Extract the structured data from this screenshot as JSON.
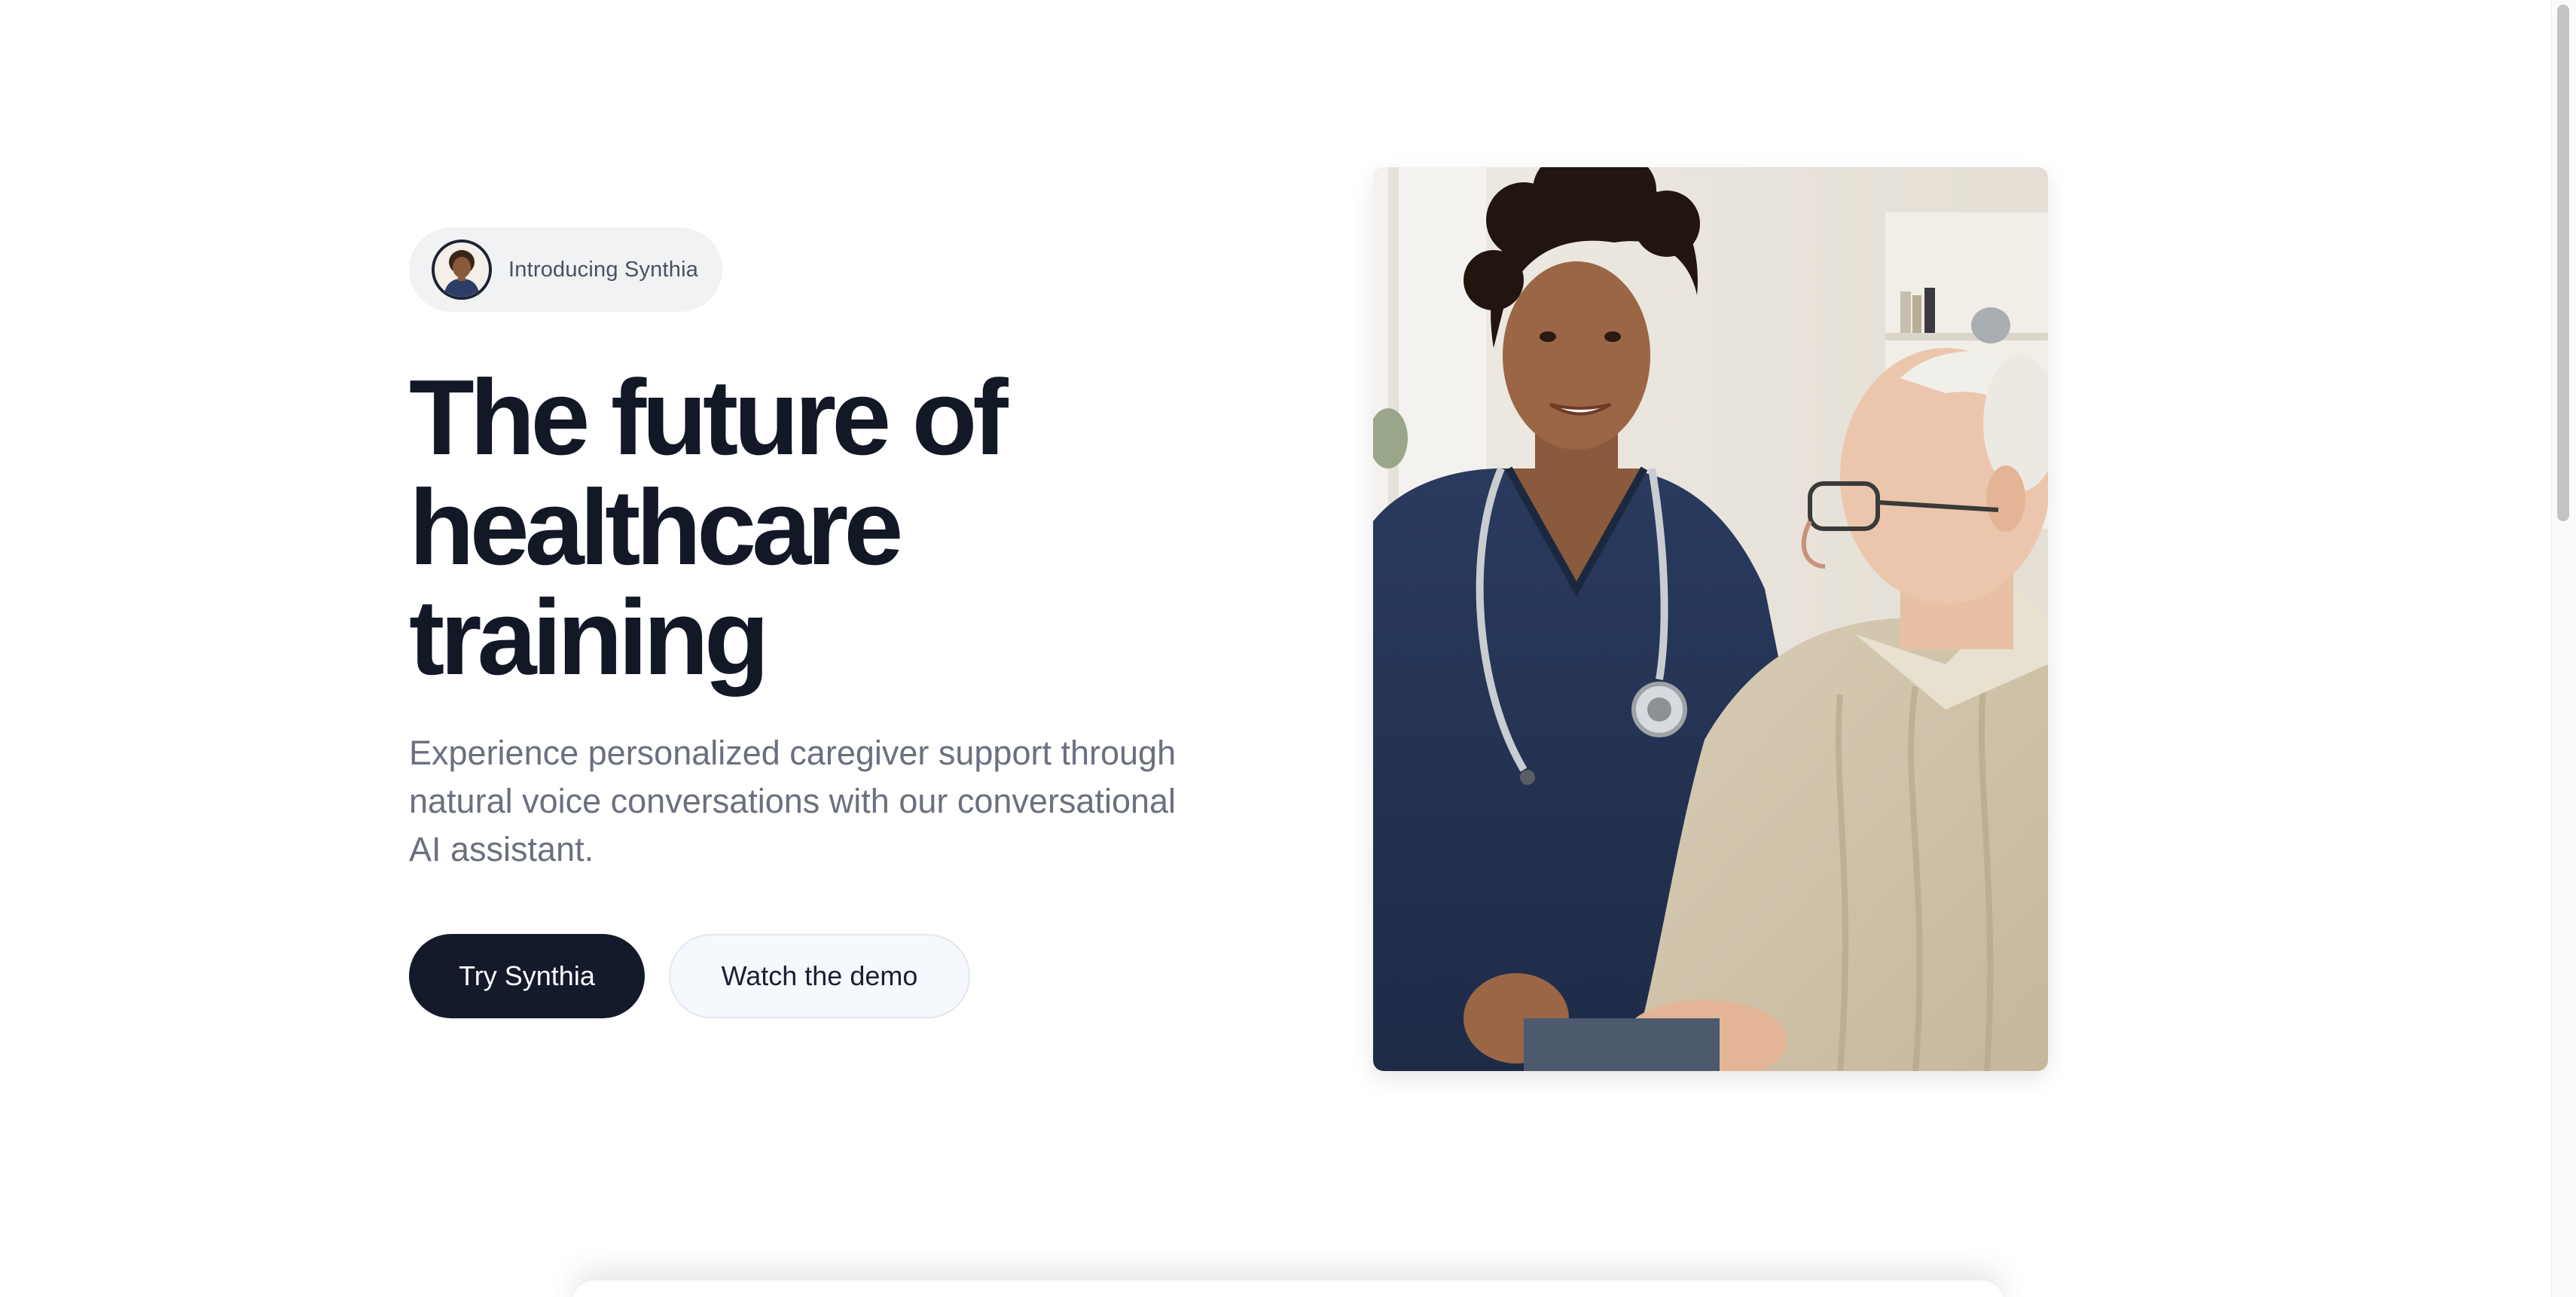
{
  "hero": {
    "intro_label": "Introducing Synthia",
    "avatar_icon": "synthia-avatar-icon",
    "headline_lines": [
      "The future of",
      "healthcare",
      "training"
    ],
    "subhead": "Experience personalized caregiver support through natural voice conversations with our conversational AI assistant.",
    "primary_cta": "Try Synthia",
    "secondary_cta": "Watch the demo"
  },
  "image": {
    "subject": "hero-photo"
  },
  "colors": {
    "headline": "#121826",
    "subhead": "#6b7080",
    "primary_button": "#141a2a",
    "secondary_button": "#f5f8fc",
    "pill_background": "#f1f2f4"
  }
}
